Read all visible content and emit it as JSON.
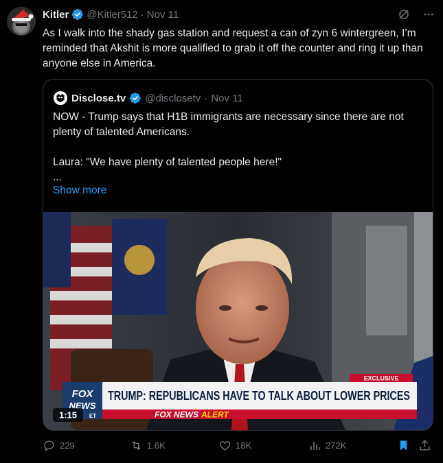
{
  "tweet": {
    "display_name": "Kitler",
    "handle": "@Kitler512",
    "separator": "·",
    "date": "Nov 11",
    "text": "As I walk into the shady gas station and request a can of zyn 6 wintergreen, I’m reminded that Akshit is more qualified to grab it off the counter and ring it up than anyone else in America."
  },
  "quote": {
    "display_name": "Disclose.tv",
    "handle": "@disclosetv",
    "separator": "·",
    "date": "Nov 11",
    "line1": "NOW - Trump says that H1B immigrants are necessary since there are not plenty of talented Americans.",
    "line2": "Laura: \"We have plenty of talented people here!\"",
    "line3": "...",
    "show_more": "Show more",
    "video": {
      "duration": "1:15",
      "exclusive_label": "EXCLUSIVE",
      "headline": "TRUMP: REPUBLICANS HAVE TO TALK ABOUT LOWER PRICES",
      "alert_prefix": "FOX NEWS",
      "alert_word": "ALERT",
      "logo_top": "FOX",
      "logo_bottom": "NEWS",
      "time_zone": "ET"
    }
  },
  "stats": {
    "replies": "229",
    "reposts": "1.6K",
    "likes": "18K",
    "views": "272K"
  },
  "icons": {
    "verified": "verified-badge-icon",
    "grok": "grok-icon",
    "more": "more-icon",
    "reply": "reply-icon",
    "repost": "repost-icon",
    "like": "like-icon",
    "views": "views-icon",
    "bookmark": "bookmark-icon",
    "share": "share-icon"
  },
  "colors": {
    "background": "#000000",
    "text": "#e7e9ea",
    "muted": "#71767b",
    "accent": "#1d9bf0",
    "border": "#2f3336",
    "fox_red": "#c8102e"
  }
}
